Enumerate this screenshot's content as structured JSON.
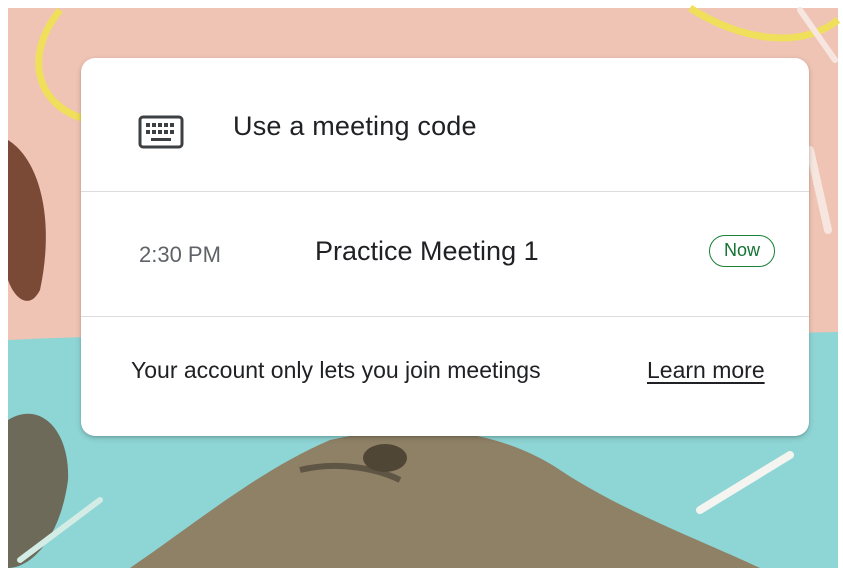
{
  "join_card": {
    "code_row": {
      "label": "Use a meeting code",
      "icon": "keyboard-icon"
    },
    "meeting_row": {
      "time": "2:30 PM",
      "title": "Practice Meeting 1",
      "badge": "Now"
    },
    "info_row": {
      "text": "Your account only lets you join meetings",
      "link": "Learn more"
    }
  },
  "colors": {
    "badge": "#188038",
    "annotation_arrow": "#e8321e",
    "background_pink": "#f2c5b6",
    "background_teal": "#8fd6d6"
  }
}
